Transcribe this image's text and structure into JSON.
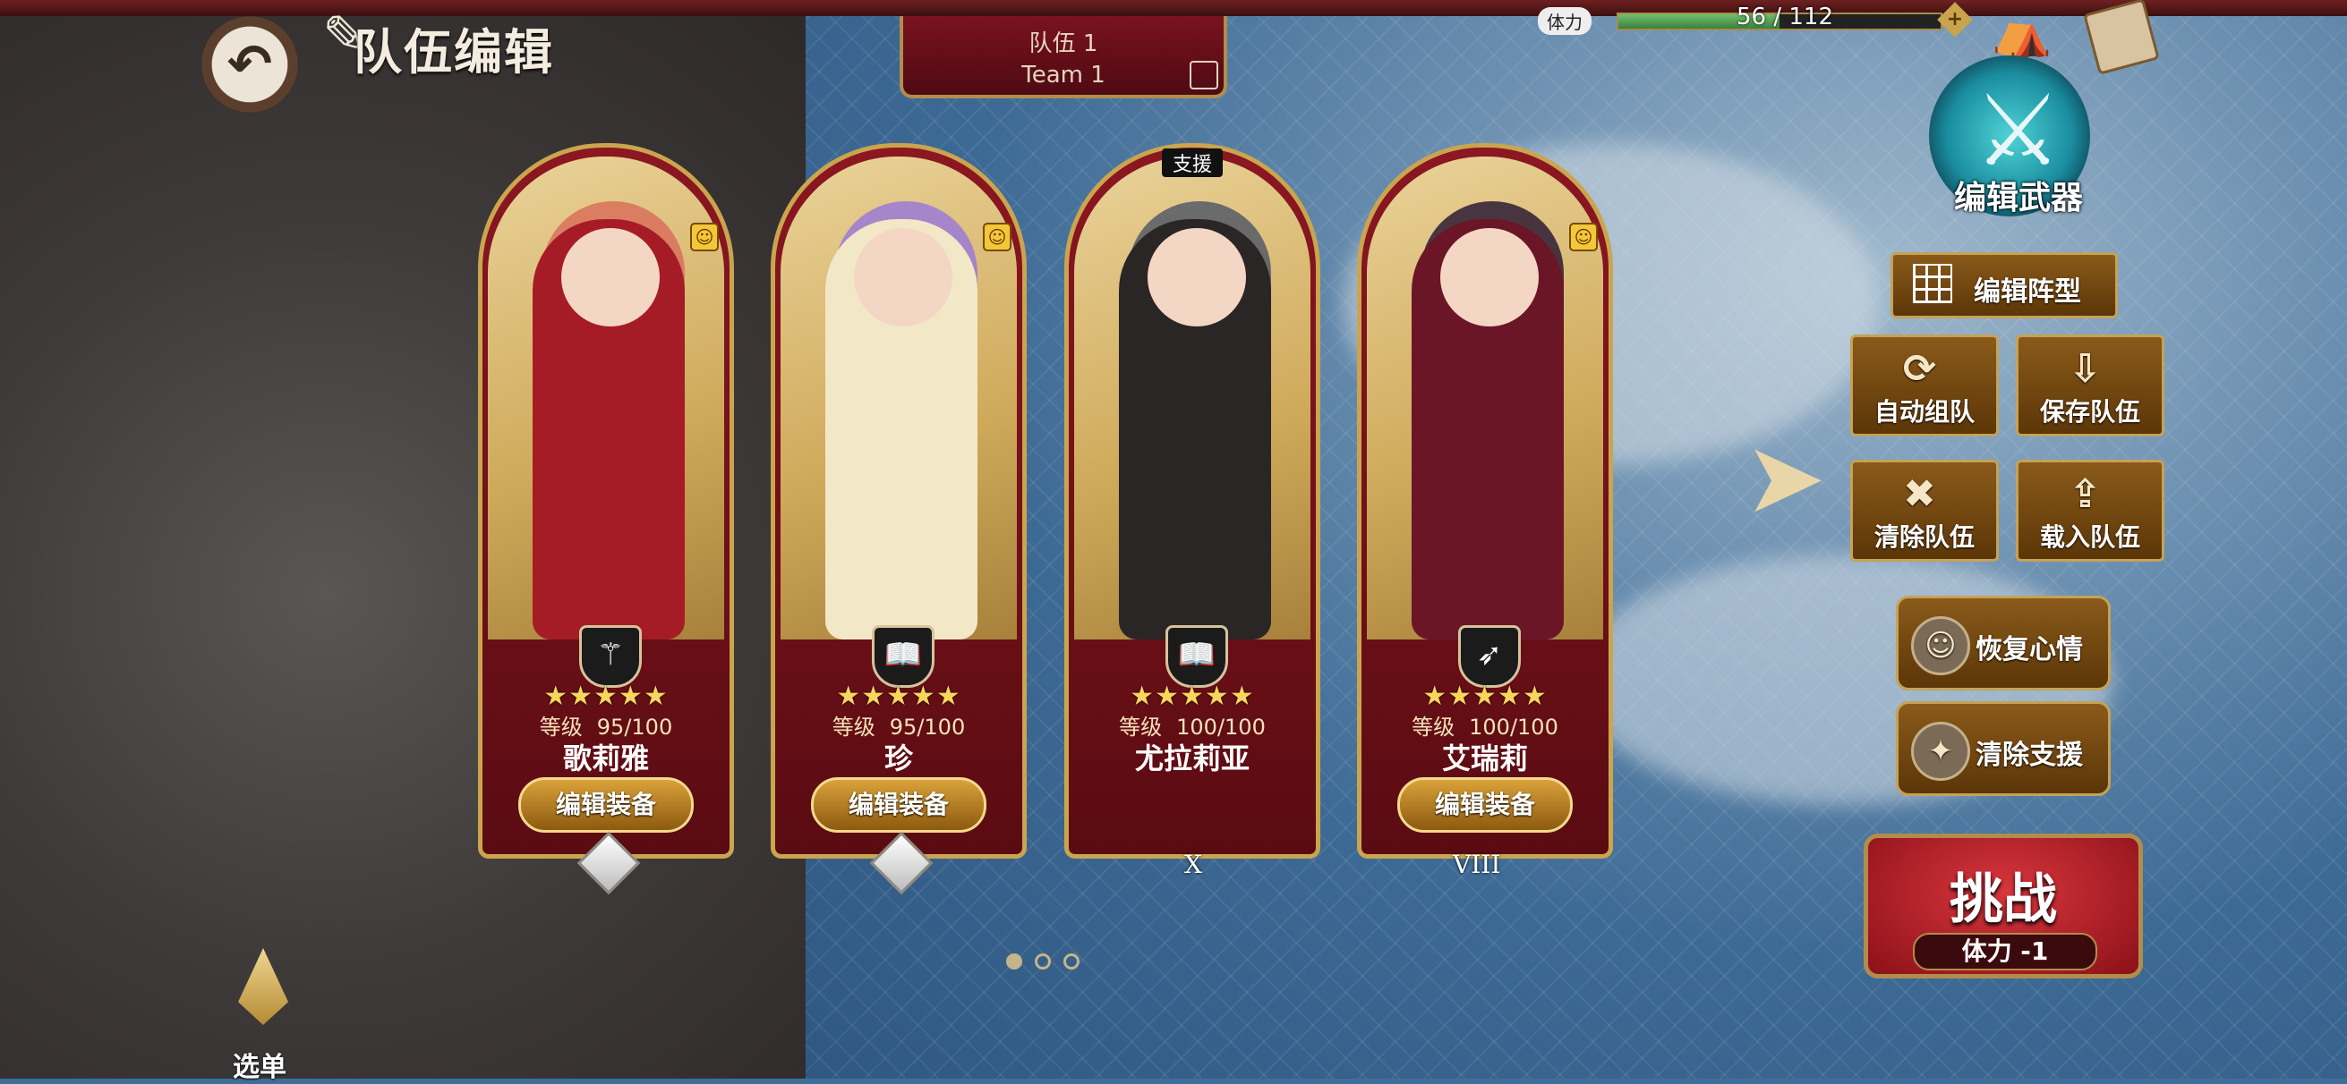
{
  "header": {
    "title": "队伍编辑",
    "team_tab": {
      "name_cn": "队伍 1",
      "name_en": "Team 1"
    }
  },
  "stamina": {
    "label": "体力",
    "current": 56,
    "max": 112,
    "text": "56 / 112"
  },
  "right_panel": {
    "edit_weapon_label": "编辑武器",
    "edit_formation_label": "编辑阵型",
    "auto_team_label": "自动组队",
    "save_team_label": "保存队伍",
    "clear_team_label": "清除队伍",
    "load_team_label": "载入队伍",
    "restore_mood_label": "恢复心情",
    "clear_support_label": "清除支援",
    "challenge_label": "挑战",
    "challenge_cost": "体力 -1"
  },
  "support_tag": "支援",
  "characters": [
    {
      "name": "歌莉雅",
      "level_label": "等级",
      "level": "95/100",
      "stars": "★★★★★",
      "equip_label": "编辑装备",
      "class_icon": "staff-icon",
      "hair": "#d9705a",
      "outfit": "#a61c26",
      "marker": "gem"
    },
    {
      "name": "珍",
      "level_label": "等级",
      "level": "95/100",
      "stars": "★★★★★",
      "equip_label": "编辑装备",
      "class_icon": "book-icon",
      "hair": "#9b7ad6",
      "outfit": "#f2e8c8",
      "marker": "gem"
    },
    {
      "name": "尤拉莉亚",
      "level_label": "等级",
      "level": "100/100",
      "stars": "★★★★★",
      "equip_label": "",
      "class_icon": "book-icon",
      "hair": "#555a66",
      "outfit": "#2a2626",
      "marker": "X"
    },
    {
      "name": "艾瑞莉",
      "level_label": "等级",
      "level": "100/100",
      "stars": "★★★★★",
      "equip_label": "编辑装备",
      "class_icon": "bow-icon",
      "hair": "#2e1b33",
      "outfit": "#6b1626",
      "marker": "VIII"
    }
  ],
  "pagination": {
    "pages": 3,
    "current": 1
  },
  "menu_label": "选单"
}
